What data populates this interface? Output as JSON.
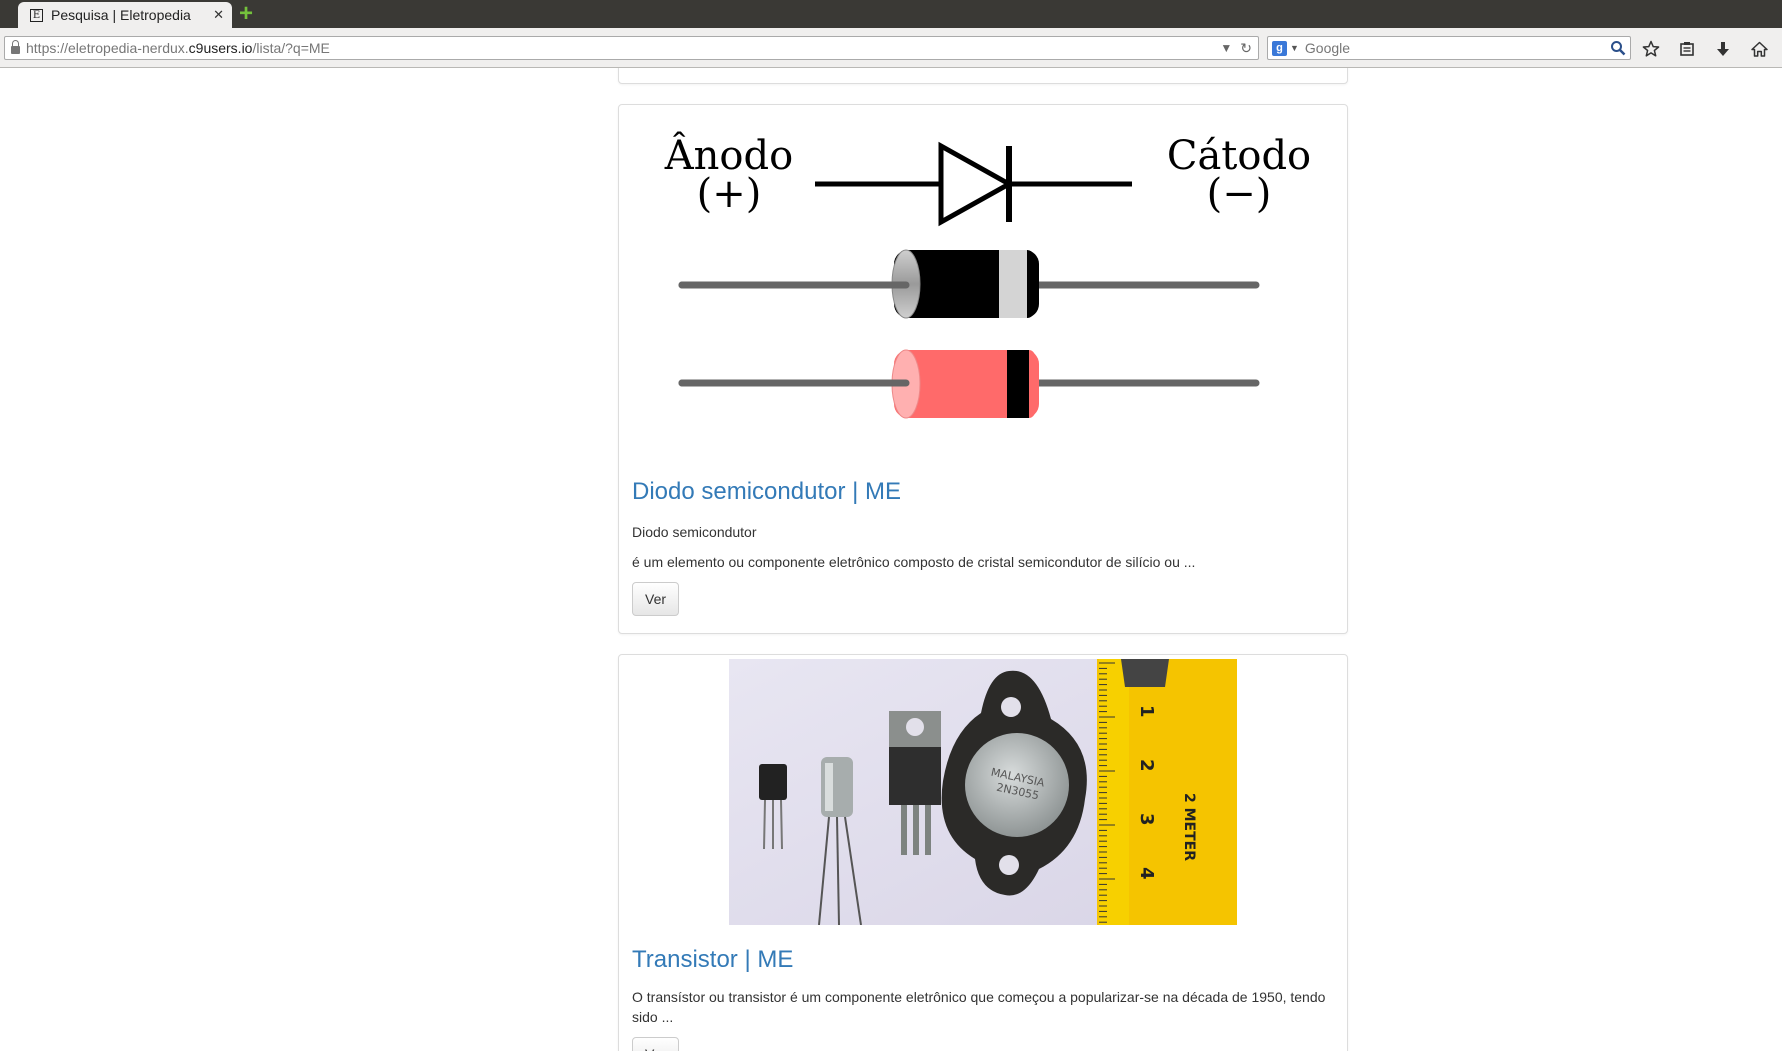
{
  "browser": {
    "tab_title": "Pesquisa | Eletropedia",
    "tab_favicon_letter": "E",
    "url_prefix": "https://eletropedia-nerdux.",
    "url_host": "c9users.io",
    "url_path": "/lista/?q=ME",
    "search_engine_letter": "g",
    "search_placeholder": "Google"
  },
  "results": [
    {
      "title": "Diodo semicondutor | ME",
      "subtitle": "Diodo semicondutor",
      "description": "é um elemento ou componente eletrônico composto de cristal semicondutor de silício ou ...",
      "button_label": "Ver",
      "figure": {
        "anode_label": "Ânodo",
        "anode_sign": "(+)",
        "cathode_label": "Cátodo",
        "cathode_sign": "(−)"
      }
    },
    {
      "title": "Transistor | ME",
      "description": "O transístor ou transistor é um componente eletrônico que começou a popularizar-se na década de 1950, tendo sido ...",
      "button_label": "Ver",
      "figure": {
        "package_label_1": "MALAYSIA",
        "package_label_2": "2N3055",
        "ruler_numbers": [
          "1",
          "2",
          "3",
          "4"
        ],
        "ruler_text": "2 METER"
      }
    }
  ],
  "colors": {
    "link": "#337ab7",
    "tab_bar": "#3a3935",
    "new_tab_plus": "#74c23c"
  }
}
